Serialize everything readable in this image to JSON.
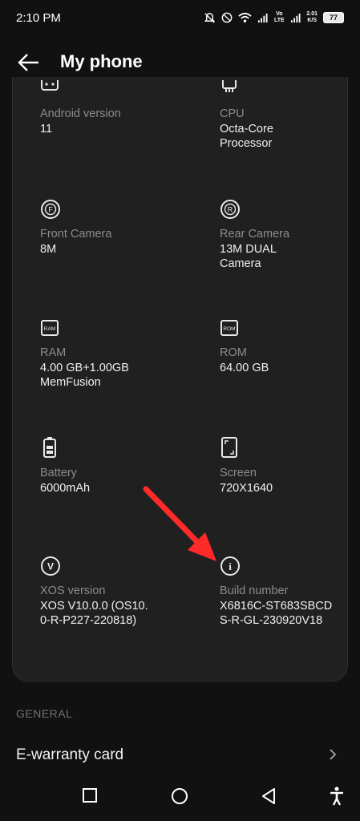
{
  "status": {
    "time": "2:10 PM",
    "netspeed_value": "2.01",
    "netspeed_unit": "K/S",
    "volte": "Vo LTE",
    "battery": "77"
  },
  "header": {
    "title": "My phone"
  },
  "specs": [
    {
      "label": "Android version",
      "value": "11",
      "icon": "android-icon"
    },
    {
      "label": "CPU",
      "value": "Octa-Core\nProcessor",
      "icon": "cpu-icon"
    },
    {
      "label": "Front Camera",
      "value": "8M",
      "icon": "front-camera-icon",
      "icon_text": "F"
    },
    {
      "label": "Rear Camera",
      "value": "13M DUAL\n Camera",
      "icon": "rear-camera-icon",
      "icon_text": "R"
    },
    {
      "label": "RAM",
      "value": "4.00 GB+1.00GB\nMemFusion",
      "icon": "ram-icon",
      "icon_text": "RAM"
    },
    {
      "label": "ROM",
      "value": "64.00 GB",
      "icon": "rom-icon",
      "icon_text": "ROM"
    },
    {
      "label": "Battery",
      "value": "6000mAh",
      "icon": "battery-icon"
    },
    {
      "label": "Screen",
      "value": "720X1640",
      "icon": "screen-icon"
    },
    {
      "label": "XOS version",
      "value": "XOS V10.0.0 (OS10.\n0-R-P227-220818)",
      "icon": "xos-icon",
      "icon_text": "V"
    },
    {
      "label": "Build number",
      "value": "X6816C-ST683SBCD\nS-R-GL-230920V18",
      "icon": "info-icon",
      "icon_text": "i"
    }
  ],
  "general": {
    "header": "GENERAL",
    "items": [
      {
        "label": "E-warranty card"
      }
    ]
  },
  "colors": {
    "background": "#111111",
    "card": "#202020",
    "annotation_arrow": "#ff2a2a"
  }
}
